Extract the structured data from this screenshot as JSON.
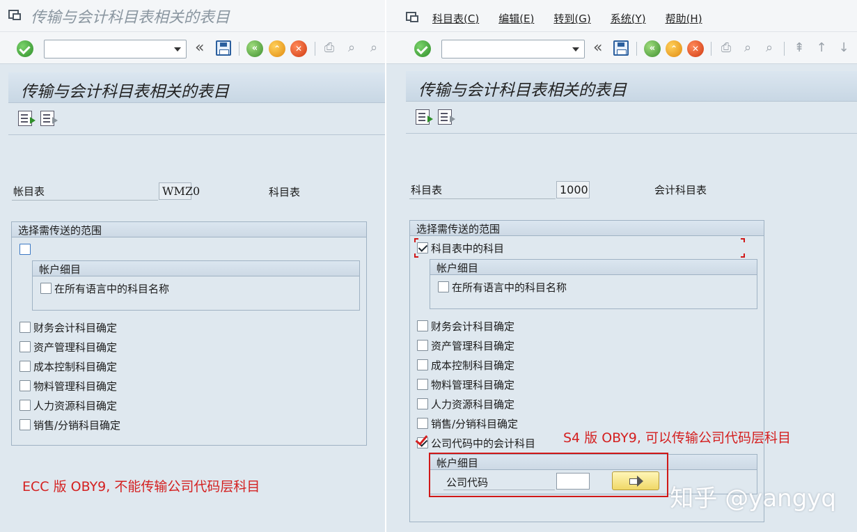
{
  "left": {
    "window_title": "传输与会计科目表相关的表目",
    "header_title": "传输与会计科目表相关的表目",
    "fields": {
      "account_chart_label": "帐目表",
      "account_chart_value": "WMZ0",
      "account_chart_desc": "科目表"
    },
    "group": {
      "title": "选择需传送的范围",
      "sub_group_title": "帐户细目",
      "sub_item": "在所有语言中的科目名称",
      "items": [
        "财务会计科目确定",
        "资产管理科目确定",
        "成本控制科目确定",
        "物料管理科目确定",
        "人力资源科目确定",
        "销售/分销科目确定"
      ]
    },
    "annotation": "ECC 版 OBY9, 不能传输公司代码层科目"
  },
  "right": {
    "menu": [
      "科目表(C)",
      "编辑(E)",
      "转到(G)",
      "系统(Y)",
      "帮助(H)"
    ],
    "header_title": "传输与会计科目表相关的表目",
    "fields": {
      "chart_label": "科目表",
      "chart_value": "1000",
      "chart_desc": "会计科目表"
    },
    "group": {
      "title": "选择需传送的范围",
      "accounts_in_chart": "科目表中的科目",
      "sub_group_title": "帐户细目",
      "sub_item": "在所有语言中的科目名称",
      "items": [
        "财务会计科目确定",
        "资产管理科目确定",
        "成本控制科目确定",
        "物料管理科目确定",
        "人力资源科目确定",
        "销售/分销科目确定"
      ],
      "company_code_accounts": "公司代码中的会计科目",
      "cc_sub_group_title": "帐户细目",
      "company_code_label": "公司代码",
      "company_code_value": ""
    },
    "annotation": "S4 版 OBY9, 可以传输公司代码层科目"
  },
  "watermark": "知乎 @yangyq",
  "colors": {
    "annotation_red": "#d42020",
    "sap_background": "#dfe8ef",
    "ok_green": "#2f8f2a"
  },
  "icons": [
    "window-icon",
    "enter-icon",
    "save-icon",
    "back-icon",
    "exit-icon",
    "cancel-icon",
    "print-icon",
    "find-icon",
    "find-next-icon",
    "first-page-icon",
    "previous-page-icon",
    "next-page-icon",
    "select-all-icon",
    "deselect-icon",
    "execute-arrow-icon"
  ]
}
